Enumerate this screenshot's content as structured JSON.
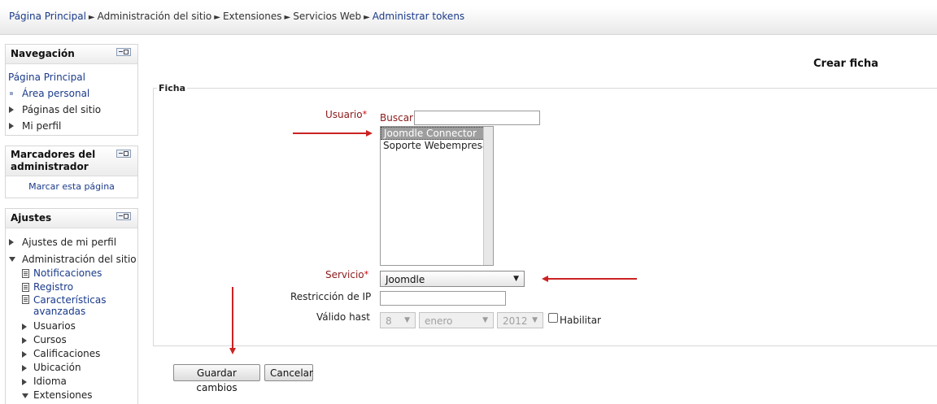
{
  "breadcrumb": {
    "items": [
      "Página Principal",
      "Administración del sitio",
      "Extensiones",
      "Servicios Web",
      "Administrar tokens"
    ],
    "separator": "►"
  },
  "sidebar": {
    "navegacion": {
      "title": "Navegación",
      "home": "Página Principal",
      "items": [
        "Área personal",
        "Páginas del sitio",
        "Mi perfil"
      ]
    },
    "marcadores": {
      "title_line1": "Marcadores del",
      "title_line2": "administrador",
      "link": "Marcar esta página"
    },
    "ajustes": {
      "title": "Ajustes",
      "items": [
        "Ajustes de mi perfil",
        "Administración del sitio",
        "Notificaciones",
        "Registro",
        "Características",
        "avanzadas",
        "Usuarios",
        "Cursos",
        "Calificaciones",
        "Ubicación",
        "Idioma",
        "Extensiones"
      ]
    }
  },
  "main": {
    "heading": "Crear ficha",
    "legend": "Ficha",
    "usuario_label": "Usuario",
    "required_mark": "*",
    "buscar_label": "Buscar",
    "buscar_value": "",
    "users": [
      "Joomdle Connector",
      "Soporte Webempresa"
    ],
    "servicio_label": "Servicio",
    "servicio_value": "Joomdle",
    "restriccion_label": "Restricción de IP",
    "restriccion_value": "",
    "valido_label": "Válido hast",
    "valido_day": "8",
    "valido_month": "enero",
    "valido_year": "2012",
    "habilitar_label": "Habilitar",
    "habilitar_checked": false,
    "save_label": "Guardar cambios",
    "cancel_label": "Cancelar"
  },
  "colors": {
    "link": "#1a3a8a",
    "required_label": "#8a1a1a",
    "arrow_annotation": "#cc2222"
  }
}
